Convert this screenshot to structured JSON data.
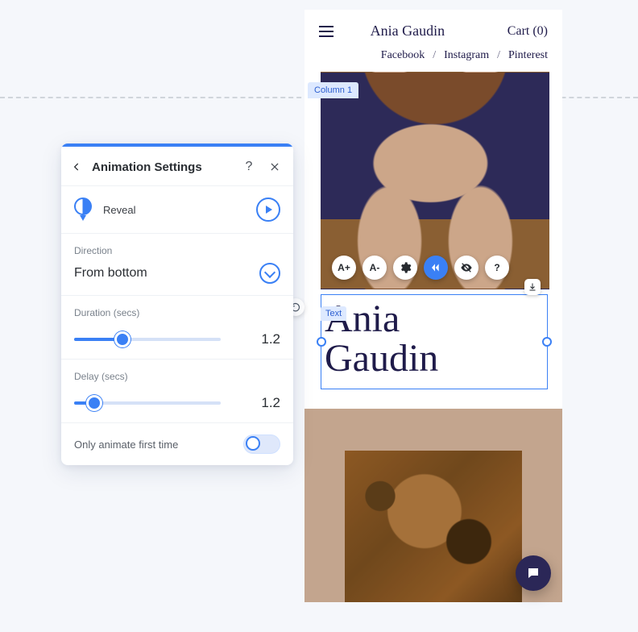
{
  "phone": {
    "site_title": "Ania Gaudin",
    "cart": "Cart (0)",
    "socials": [
      "Facebook",
      "Instagram",
      "Pinterest"
    ],
    "column_tag": "Column 1",
    "text_tag": "Text",
    "display_name_line1": "Ania",
    "display_name_line2": "Gaudin"
  },
  "chips": {
    "a_inc": "A+",
    "a_dec": "A-"
  },
  "panel": {
    "title": "Animation Settings",
    "help": "?",
    "reveal": "Reveal",
    "direction_label": "Direction",
    "direction_value": "From bottom",
    "duration_label": "Duration (secs)",
    "duration_value": "1.2",
    "duration_fill_pct": 33,
    "delay_label": "Delay (secs)",
    "delay_value": "1.2",
    "delay_fill_pct": 14,
    "only_first": "Only animate first time"
  }
}
